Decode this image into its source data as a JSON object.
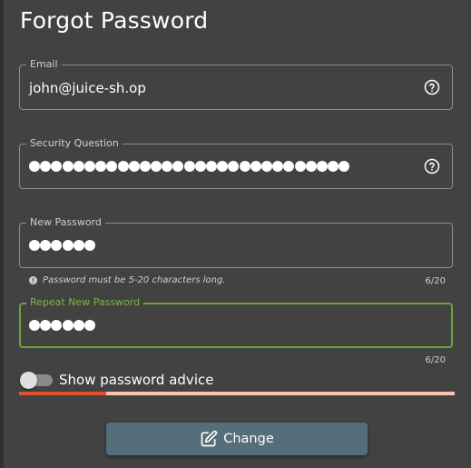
{
  "page": {
    "title": "Forgot Password"
  },
  "form": {
    "email": {
      "label": "Email",
      "value": "john@juice-sh.op",
      "icon": "help-circle-icon"
    },
    "security_question": {
      "label": "Security Question",
      "masked_length": 29,
      "icon": "help-circle-icon"
    },
    "new_password": {
      "label": "New Password",
      "masked_length": 6,
      "hint": "Password must be 5-20 characters long.",
      "counter": "6/20"
    },
    "repeat_password": {
      "label": "Repeat New Password",
      "masked_length": 6,
      "counter": "6/20",
      "focused": true
    },
    "password_advice": {
      "label": "Show password advice",
      "enabled": false
    },
    "strength": {
      "fraction": 0.2,
      "fill_color": "#e0502d",
      "track_color": "#f8c3b4"
    },
    "submit": {
      "label": "Change",
      "icon": "edit-icon"
    }
  },
  "colors": {
    "background": "#424242",
    "focus_accent": "#69a33a",
    "button": "#546e7a"
  }
}
